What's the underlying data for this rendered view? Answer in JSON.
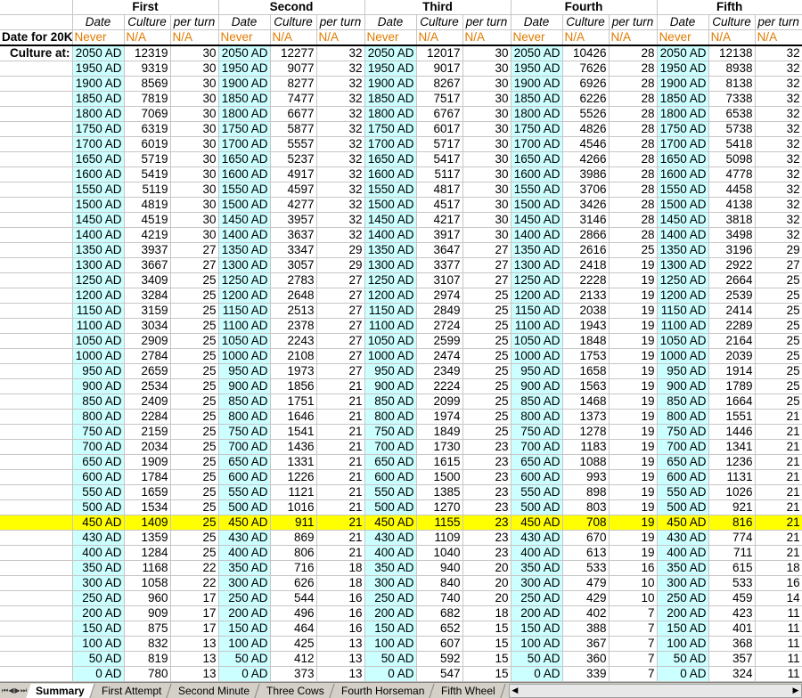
{
  "groups": [
    "First",
    "Second",
    "Third",
    "Fourth",
    "Fifth"
  ],
  "sub_headers": [
    "Date",
    "Culture",
    "per turn"
  ],
  "date20k_label": "Date for 20K",
  "date20k_values": [
    "Never",
    "N/A",
    "N/A"
  ],
  "culture_label": "Culture at:",
  "highlight_row_index": 31,
  "rows": [
    [
      "2050 AD",
      "12319",
      "30",
      "2050 AD",
      "12277",
      "32",
      "2050 AD",
      "12017",
      "30",
      "2050 AD",
      "10426",
      "28",
      "2050 AD",
      "12138",
      "32"
    ],
    [
      "1950 AD",
      "9319",
      "30",
      "1950 AD",
      "9077",
      "32",
      "1950 AD",
      "9017",
      "30",
      "1950 AD",
      "7626",
      "28",
      "1950 AD",
      "8938",
      "32"
    ],
    [
      "1900 AD",
      "8569",
      "30",
      "1900 AD",
      "8277",
      "32",
      "1900 AD",
      "8267",
      "30",
      "1900 AD",
      "6926",
      "28",
      "1900 AD",
      "8138",
      "32"
    ],
    [
      "1850 AD",
      "7819",
      "30",
      "1850 AD",
      "7477",
      "32",
      "1850 AD",
      "7517",
      "30",
      "1850 AD",
      "6226",
      "28",
      "1850 AD",
      "7338",
      "32"
    ],
    [
      "1800 AD",
      "7069",
      "30",
      "1800 AD",
      "6677",
      "32",
      "1800 AD",
      "6767",
      "30",
      "1800 AD",
      "5526",
      "28",
      "1800 AD",
      "6538",
      "32"
    ],
    [
      "1750 AD",
      "6319",
      "30",
      "1750 AD",
      "5877",
      "32",
      "1750 AD",
      "6017",
      "30",
      "1750 AD",
      "4826",
      "28",
      "1750 AD",
      "5738",
      "32"
    ],
    [
      "1700 AD",
      "6019",
      "30",
      "1700 AD",
      "5557",
      "32",
      "1700 AD",
      "5717",
      "30",
      "1700 AD",
      "4546",
      "28",
      "1700 AD",
      "5418",
      "32"
    ],
    [
      "1650 AD",
      "5719",
      "30",
      "1650 AD",
      "5237",
      "32",
      "1650 AD",
      "5417",
      "30",
      "1650 AD",
      "4266",
      "28",
      "1650 AD",
      "5098",
      "32"
    ],
    [
      "1600 AD",
      "5419",
      "30",
      "1600 AD",
      "4917",
      "32",
      "1600 AD",
      "5117",
      "30",
      "1600 AD",
      "3986",
      "28",
      "1600 AD",
      "4778",
      "32"
    ],
    [
      "1550 AD",
      "5119",
      "30",
      "1550 AD",
      "4597",
      "32",
      "1550 AD",
      "4817",
      "30",
      "1550 AD",
      "3706",
      "28",
      "1550 AD",
      "4458",
      "32"
    ],
    [
      "1500 AD",
      "4819",
      "30",
      "1500 AD",
      "4277",
      "32",
      "1500 AD",
      "4517",
      "30",
      "1500 AD",
      "3426",
      "28",
      "1500 AD",
      "4138",
      "32"
    ],
    [
      "1450 AD",
      "4519",
      "30",
      "1450 AD",
      "3957",
      "32",
      "1450 AD",
      "4217",
      "30",
      "1450 AD",
      "3146",
      "28",
      "1450 AD",
      "3818",
      "32"
    ],
    [
      "1400 AD",
      "4219",
      "30",
      "1400 AD",
      "3637",
      "32",
      "1400 AD",
      "3917",
      "30",
      "1400 AD",
      "2866",
      "28",
      "1400 AD",
      "3498",
      "32"
    ],
    [
      "1350 AD",
      "3937",
      "27",
      "1350 AD",
      "3347",
      "29",
      "1350 AD",
      "3647",
      "27",
      "1350 AD",
      "2616",
      "25",
      "1350 AD",
      "3196",
      "29"
    ],
    [
      "1300 AD",
      "3667",
      "27",
      "1300 AD",
      "3057",
      "29",
      "1300 AD",
      "3377",
      "27",
      "1300 AD",
      "2418",
      "19",
      "1300 AD",
      "2922",
      "27"
    ],
    [
      "1250 AD",
      "3409",
      "25",
      "1250 AD",
      "2783",
      "27",
      "1250 AD",
      "3107",
      "27",
      "1250 AD",
      "2228",
      "19",
      "1250 AD",
      "2664",
      "25"
    ],
    [
      "1200 AD",
      "3284",
      "25",
      "1200 AD",
      "2648",
      "27",
      "1200 AD",
      "2974",
      "25",
      "1200 AD",
      "2133",
      "19",
      "1200 AD",
      "2539",
      "25"
    ],
    [
      "1150 AD",
      "3159",
      "25",
      "1150 AD",
      "2513",
      "27",
      "1150 AD",
      "2849",
      "25",
      "1150 AD",
      "2038",
      "19",
      "1150 AD",
      "2414",
      "25"
    ],
    [
      "1100 AD",
      "3034",
      "25",
      "1100 AD",
      "2378",
      "27",
      "1100 AD",
      "2724",
      "25",
      "1100 AD",
      "1943",
      "19",
      "1100 AD",
      "2289",
      "25"
    ],
    [
      "1050 AD",
      "2909",
      "25",
      "1050 AD",
      "2243",
      "27",
      "1050 AD",
      "2599",
      "25",
      "1050 AD",
      "1848",
      "19",
      "1050 AD",
      "2164",
      "25"
    ],
    [
      "1000 AD",
      "2784",
      "25",
      "1000 AD",
      "2108",
      "27",
      "1000 AD",
      "2474",
      "25",
      "1000 AD",
      "1753",
      "19",
      "1000 AD",
      "2039",
      "25"
    ],
    [
      "950 AD",
      "2659",
      "25",
      "950 AD",
      "1973",
      "27",
      "950 AD",
      "2349",
      "25",
      "950 AD",
      "1658",
      "19",
      "950 AD",
      "1914",
      "25"
    ],
    [
      "900 AD",
      "2534",
      "25",
      "900 AD",
      "1856",
      "21",
      "900 AD",
      "2224",
      "25",
      "900 AD",
      "1563",
      "19",
      "900 AD",
      "1789",
      "25"
    ],
    [
      "850 AD",
      "2409",
      "25",
      "850 AD",
      "1751",
      "21",
      "850 AD",
      "2099",
      "25",
      "850 AD",
      "1468",
      "19",
      "850 AD",
      "1664",
      "25"
    ],
    [
      "800 AD",
      "2284",
      "25",
      "800 AD",
      "1646",
      "21",
      "800 AD",
      "1974",
      "25",
      "800 AD",
      "1373",
      "19",
      "800 AD",
      "1551",
      "21"
    ],
    [
      "750 AD",
      "2159",
      "25",
      "750 AD",
      "1541",
      "21",
      "750 AD",
      "1849",
      "25",
      "750 AD",
      "1278",
      "19",
      "750 AD",
      "1446",
      "21"
    ],
    [
      "700 AD",
      "2034",
      "25",
      "700 AD",
      "1436",
      "21",
      "700 AD",
      "1730",
      "23",
      "700 AD",
      "1183",
      "19",
      "700 AD",
      "1341",
      "21"
    ],
    [
      "650 AD",
      "1909",
      "25",
      "650 AD",
      "1331",
      "21",
      "650 AD",
      "1615",
      "23",
      "650 AD",
      "1088",
      "19",
      "650 AD",
      "1236",
      "21"
    ],
    [
      "600 AD",
      "1784",
      "25",
      "600 AD",
      "1226",
      "21",
      "600 AD",
      "1500",
      "23",
      "600 AD",
      "993",
      "19",
      "600 AD",
      "1131",
      "21"
    ],
    [
      "550 AD",
      "1659",
      "25",
      "550 AD",
      "1121",
      "21",
      "550 AD",
      "1385",
      "23",
      "550 AD",
      "898",
      "19",
      "550 AD",
      "1026",
      "21"
    ],
    [
      "500 AD",
      "1534",
      "25",
      "500 AD",
      "1016",
      "21",
      "500 AD",
      "1270",
      "23",
      "500 AD",
      "803",
      "19",
      "500 AD",
      "921",
      "21"
    ],
    [
      "450 AD",
      "1409",
      "25",
      "450 AD",
      "911",
      "21",
      "450 AD",
      "1155",
      "23",
      "450 AD",
      "708",
      "19",
      "450 AD",
      "816",
      "21"
    ],
    [
      "430 AD",
      "1359",
      "25",
      "430 AD",
      "869",
      "21",
      "430 AD",
      "1109",
      "23",
      "430 AD",
      "670",
      "19",
      "430 AD",
      "774",
      "21"
    ],
    [
      "400 AD",
      "1284",
      "25",
      "400 AD",
      "806",
      "21",
      "400 AD",
      "1040",
      "23",
      "400 AD",
      "613",
      "19",
      "400 AD",
      "711",
      "21"
    ],
    [
      "350 AD",
      "1168",
      "22",
      "350 AD",
      "716",
      "18",
      "350 AD",
      "940",
      "20",
      "350 AD",
      "533",
      "16",
      "350 AD",
      "615",
      "18"
    ],
    [
      "300 AD",
      "1058",
      "22",
      "300 AD",
      "626",
      "18",
      "300 AD",
      "840",
      "20",
      "300 AD",
      "479",
      "10",
      "300 AD",
      "533",
      "16"
    ],
    [
      "250 AD",
      "960",
      "17",
      "250 AD",
      "544",
      "16",
      "250 AD",
      "740",
      "20",
      "250 AD",
      "429",
      "10",
      "250 AD",
      "459",
      "14"
    ],
    [
      "200 AD",
      "909",
      "17",
      "200 AD",
      "496",
      "16",
      "200 AD",
      "682",
      "18",
      "200 AD",
      "402",
      "7",
      "200 AD",
      "423",
      "11"
    ],
    [
      "150 AD",
      "875",
      "17",
      "150 AD",
      "464",
      "16",
      "150 AD",
      "652",
      "15",
      "150 AD",
      "388",
      "7",
      "150 AD",
      "401",
      "11"
    ],
    [
      "100 AD",
      "832",
      "13",
      "100 AD",
      "425",
      "13",
      "100 AD",
      "607",
      "15",
      "100 AD",
      "367",
      "7",
      "100 AD",
      "368",
      "11"
    ],
    [
      "50 AD",
      "819",
      "13",
      "50 AD",
      "412",
      "13",
      "50 AD",
      "592",
      "15",
      "50 AD",
      "360",
      "7",
      "50 AD",
      "357",
      "11"
    ],
    [
      "0 AD",
      "780",
      "13",
      "0 AD",
      "373",
      "13",
      "0 AD",
      "547",
      "15",
      "0 AD",
      "339",
      "7",
      "0 AD",
      "324",
      "11"
    ]
  ],
  "tabs": [
    "Summary",
    "First Attempt",
    "Second Minute",
    "Three Cows",
    "Fourth Horseman",
    "Fifth Wheel"
  ],
  "active_tab": "Summary",
  "colors": {
    "date_bg": "#ccffff",
    "highlight": "#ffff00",
    "never_text": "#e07a00"
  }
}
